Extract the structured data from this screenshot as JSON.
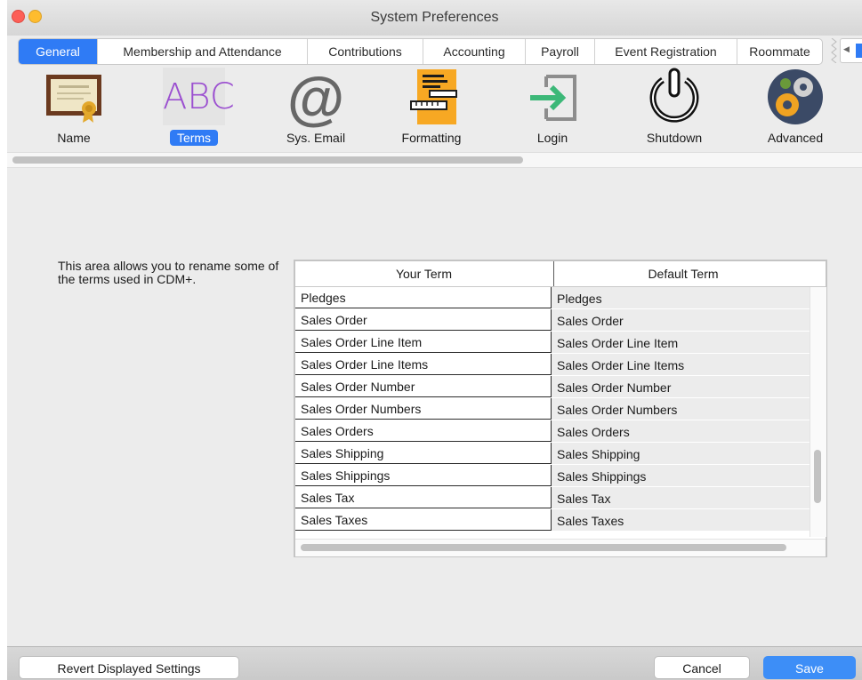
{
  "window": {
    "title": "System Preferences"
  },
  "tabs": [
    {
      "label": "General",
      "active": true
    },
    {
      "label": "Membership and Attendance",
      "active": false
    },
    {
      "label": "Contributions",
      "active": false
    },
    {
      "label": "Accounting",
      "active": false
    },
    {
      "label": "Payroll",
      "active": false
    },
    {
      "label": "Event Registration",
      "active": false
    },
    {
      "label": "Roommate",
      "active": false
    }
  ],
  "prefs": [
    {
      "label": "Name",
      "icon": "certificate-icon",
      "selected": false
    },
    {
      "label": "Terms",
      "icon": "abc-text-icon",
      "selected": true
    },
    {
      "label": "Sys. Email",
      "icon": "at-sign-icon",
      "selected": false
    },
    {
      "label": "Formatting",
      "icon": "ruler-pencil-icon",
      "selected": false
    },
    {
      "label": "Login",
      "icon": "login-arrow-icon",
      "selected": false
    },
    {
      "label": "Shutdown",
      "icon": "power-icon",
      "selected": false
    },
    {
      "label": "Advanced",
      "icon": "gears-icon",
      "selected": false
    }
  ],
  "icon_text": {
    "abc": "ABC",
    "at": "@"
  },
  "description": "This area allows you to rename some of the terms used in CDM+.",
  "table": {
    "columns": [
      "Your Term",
      "Default Term"
    ],
    "rows": [
      [
        "Pledges",
        "Pledges"
      ],
      [
        "Sales Order",
        "Sales Order"
      ],
      [
        "Sales Order Line Item",
        "Sales Order Line Item"
      ],
      [
        "Sales Order Line Items",
        "Sales Order Line Items"
      ],
      [
        "Sales Order Number",
        "Sales Order Number"
      ],
      [
        "Sales Order Numbers",
        "Sales Order Numbers"
      ],
      [
        "Sales Orders",
        "Sales Orders"
      ],
      [
        "Sales Shipping",
        "Sales Shipping"
      ],
      [
        "Sales Shippings",
        "Sales Shippings"
      ],
      [
        "Sales Tax",
        "Sales Tax"
      ],
      [
        "Sales Taxes",
        "Sales Taxes"
      ]
    ]
  },
  "buttons": {
    "revert": "Revert Displayed Settings",
    "cancel": "Cancel",
    "save": "Save"
  },
  "colors": {
    "accent": "#2f7bf5",
    "abc_purple": "#9b4fd0",
    "login_green": "#3cb878",
    "formatting_orange": "#f7a823",
    "gear_orange": "#f0a322"
  }
}
